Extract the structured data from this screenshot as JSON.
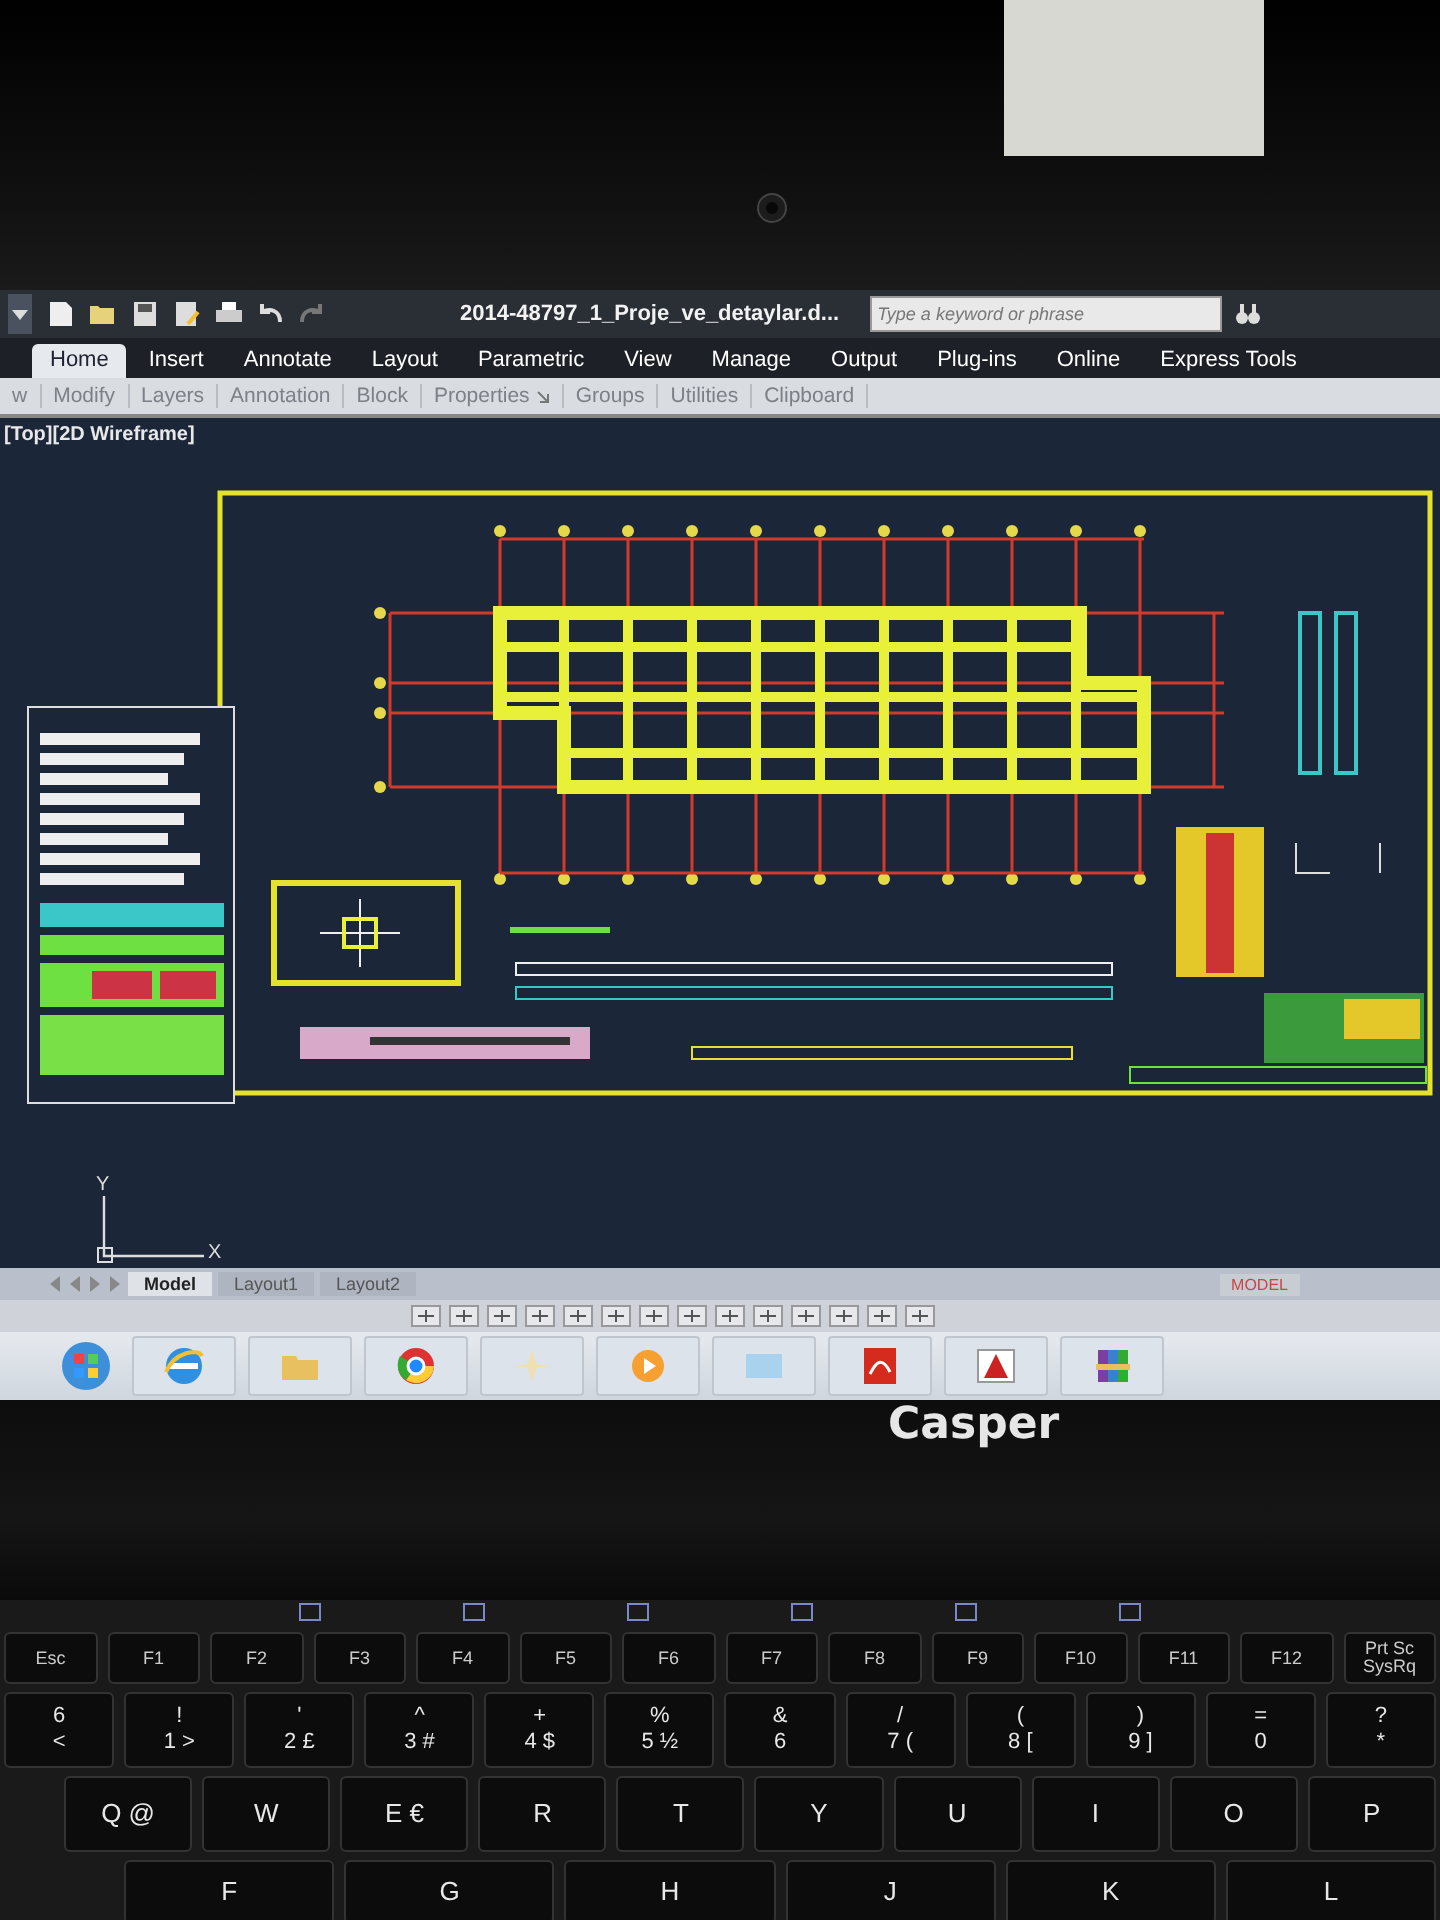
{
  "quick_access": {
    "title": "2014-48797_1_Proje_ve_detaylar.d...",
    "search": {
      "placeholder": "Type a keyword or phrase"
    }
  },
  "ribbon_tabs": [
    {
      "label": "Home",
      "selected": true
    },
    {
      "label": "Insert",
      "selected": false
    },
    {
      "label": "Annotate",
      "selected": false
    },
    {
      "label": "Layout",
      "selected": false
    },
    {
      "label": "Parametric",
      "selected": false
    },
    {
      "label": "View",
      "selected": false
    },
    {
      "label": "Manage",
      "selected": false
    },
    {
      "label": "Output",
      "selected": false
    },
    {
      "label": "Plug-ins",
      "selected": false
    },
    {
      "label": "Online",
      "selected": false
    },
    {
      "label": "Express Tools",
      "selected": false
    }
  ],
  "ribbon_panels": [
    {
      "label": "w",
      "launcher": false
    },
    {
      "label": "Modify",
      "launcher": false
    },
    {
      "label": "Layers",
      "launcher": false
    },
    {
      "label": "Annotation",
      "launcher": false
    },
    {
      "label": "Block",
      "launcher": false
    },
    {
      "label": "Properties",
      "launcher": true
    },
    {
      "label": "Groups",
      "launcher": false
    },
    {
      "label": "Utilities",
      "launcher": false
    },
    {
      "label": "Clipboard",
      "launcher": false
    }
  ],
  "viewport_label": "[Top][2D Wireframe]",
  "ucs": {
    "y": "Y",
    "x": "X"
  },
  "layout_tabs": [
    {
      "label": "Model",
      "selected": true
    },
    {
      "label": "Layout1",
      "selected": false
    },
    {
      "label": "Layout2",
      "selected": false
    }
  ],
  "status_bar": {
    "mode": "MODEL"
  },
  "brand": "Casper",
  "keyboard": {
    "function_keys": [
      {
        "labels": [
          "Esc"
        ]
      },
      {
        "labels": [
          "F1"
        ]
      },
      {
        "labels": [
          "F2"
        ]
      },
      {
        "labels": [
          "F3"
        ]
      },
      {
        "labels": [
          "F4"
        ]
      },
      {
        "labels": [
          "F5"
        ]
      },
      {
        "labels": [
          "F6"
        ]
      },
      {
        "labels": [
          "F7"
        ]
      },
      {
        "labels": [
          "F8"
        ]
      },
      {
        "labels": [
          "F9"
        ]
      },
      {
        "labels": [
          "F10"
        ]
      },
      {
        "labels": [
          "F11"
        ]
      },
      {
        "labels": [
          "F12"
        ]
      },
      {
        "labels": [
          "Prt Sc",
          "SysRq"
        ]
      }
    ],
    "number_keys": [
      {
        "labels": [
          "6",
          "<"
        ]
      },
      {
        "labels": [
          "!",
          "1 >"
        ]
      },
      {
        "labels": [
          "'",
          "2 £"
        ]
      },
      {
        "labels": [
          "^",
          "3 #"
        ]
      },
      {
        "labels": [
          "+",
          "4 $"
        ]
      },
      {
        "labels": [
          "%",
          "5 ½"
        ]
      },
      {
        "labels": [
          "&",
          "6"
        ]
      },
      {
        "labels": [
          "/",
          "7 ("
        ]
      },
      {
        "labels": [
          "(",
          "8 ["
        ]
      },
      {
        "labels": [
          ")",
          "9 ]"
        ]
      },
      {
        "labels": [
          "=",
          "0"
        ]
      },
      {
        "labels": [
          "?",
          "*"
        ]
      }
    ],
    "top_letter_keys": [
      {
        "labels": [
          "Q @"
        ]
      },
      {
        "labels": [
          "W"
        ]
      },
      {
        "labels": [
          "E €"
        ]
      },
      {
        "labels": [
          "R"
        ]
      },
      {
        "labels": [
          "T"
        ]
      },
      {
        "labels": [
          "Y"
        ]
      },
      {
        "labels": [
          "U"
        ]
      },
      {
        "labels": [
          "I"
        ]
      },
      {
        "labels": [
          "O"
        ]
      },
      {
        "labels": [
          "P"
        ]
      }
    ],
    "home_letter_keys": [
      {
        "labels": [
          "F"
        ]
      },
      {
        "labels": [
          "G"
        ]
      },
      {
        "labels": [
          "H"
        ]
      },
      {
        "labels": [
          "J"
        ]
      },
      {
        "labels": [
          "K"
        ]
      },
      {
        "labels": [
          "L"
        ]
      }
    ]
  }
}
